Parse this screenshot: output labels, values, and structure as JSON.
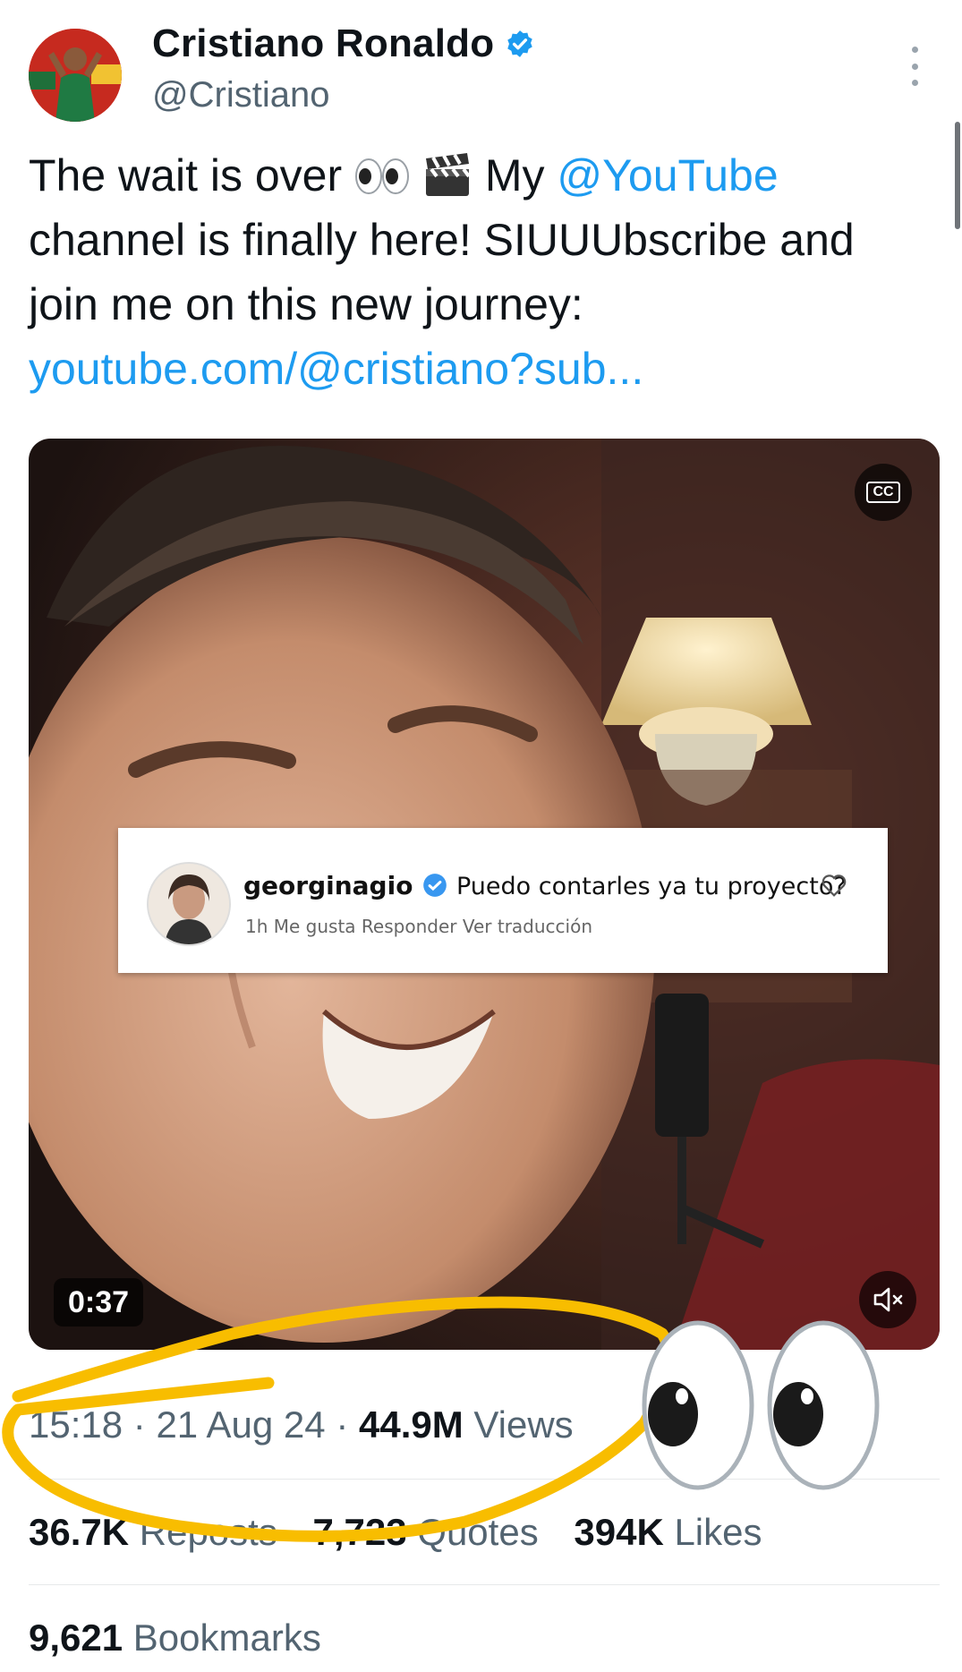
{
  "author": {
    "name": "Cristiano Ronaldo",
    "handle": "@Cristiano",
    "verified": true
  },
  "tweet": {
    "text_part1": "The wait is over",
    "text_part2": "My",
    "mention": "@YouTube",
    "text_part3": "channel is finally here! SIUUUbscribe and join me on this new journey:",
    "link": "youtube.com/@cristiano?sub..."
  },
  "video": {
    "cc_label": "CC",
    "duration": "0:37",
    "overlay_comment": {
      "username": "georginagio",
      "text": "Puedo contarles ya tu proyecto?",
      "meta": "1h Me gusta Responder Ver traducción"
    }
  },
  "meta": {
    "time": "15:18",
    "separator": "·",
    "date": "21 Aug 24",
    "views_count": "44.9M",
    "views_label": "Views"
  },
  "stats": {
    "reposts_count": "36.7K",
    "reposts_label": "Reposts",
    "quotes_count": "7,723",
    "quotes_label": "Quotes",
    "likes_count": "394K",
    "likes_label": "Likes",
    "bookmarks_count": "9,621",
    "bookmarks_label": "Bookmarks"
  },
  "colors": {
    "link": "#1d9bf0",
    "secondary_text": "#536471",
    "annotation_yellow": "#f8bd00",
    "verified_badge": "#1d9bf0"
  },
  "icons": [
    "verified-badge-icon",
    "more-options-icon",
    "eyes-emoji-icon",
    "clapper-board-icon",
    "closed-captions-icon",
    "muted-speaker-icon",
    "heart-icon"
  ]
}
